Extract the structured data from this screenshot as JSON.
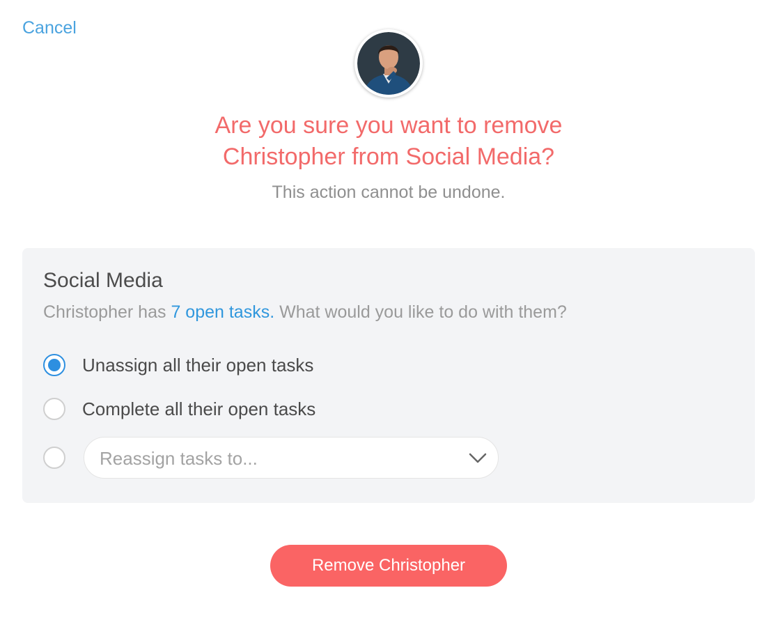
{
  "header": {
    "cancel_label": "Cancel"
  },
  "dialog": {
    "title_line1": "Are you sure you want to remove",
    "title_line2": "Christopher from Social Media?",
    "subtitle": "This action cannot be undone."
  },
  "panel": {
    "title": "Social Media",
    "desc_prefix": "Christopher has ",
    "tasks_link": "7 open tasks.",
    "desc_suffix": " What would you like to do with them?",
    "options": [
      {
        "label": "Unassign all their open tasks",
        "selected": true
      },
      {
        "label": "Complete all their open tasks",
        "selected": false
      },
      {
        "label": "",
        "selected": false
      }
    ],
    "reassign_select": {
      "placeholder": "Reassign tasks to...",
      "icon": "chevron-down-icon"
    }
  },
  "actions": {
    "remove_label": "Remove Christopher"
  },
  "colors": {
    "accent_red": "#f26a6a",
    "button_red": "#fa6464",
    "link_blue": "#4aa3df",
    "radio_blue": "#2d8fe0",
    "panel_bg": "#f3f4f6"
  }
}
